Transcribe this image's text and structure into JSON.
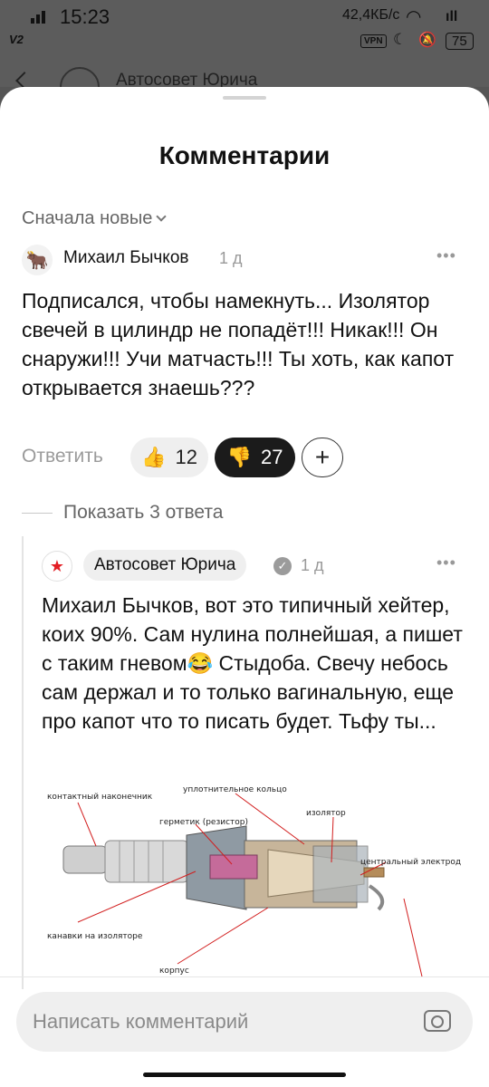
{
  "status_bar": {
    "time": "15:23",
    "carrier_tag": "V2",
    "net_speed": "42,4КБ/с",
    "vpn": "VPN",
    "battery": "75"
  },
  "background": {
    "channel_title": "Автосовет Юрича"
  },
  "sheet": {
    "title": "Комментарии",
    "sort_label": "Сначала новые"
  },
  "comment1": {
    "author": "Михаил Бычков",
    "time": "1 д",
    "text": "Подписался, чтобы намекнуть... Изолятор свечей в цилиндр не попадёт!!! Никак!!! Он снаружи!!! Учи матчасть!!! Ты хоть, как капот открывается знаешь???",
    "reply_label": "Ответить",
    "likes": "12",
    "dislikes": "27",
    "show_replies": "Показать 3 ответа"
  },
  "comment2": {
    "author": "Автосовет Юрича",
    "time": "1 д",
    "text": "Михаил Бычков, вот это типичный хейтер, коих 90%. Сам нулина полнейшая, а пишет с таким гневом😂 Стыдоба. Свечу небось сам держал и то только вагинальную, еще про капот что то писать будет. Тьфу ты...",
    "image_labels": {
      "tip": "контактный наконечник",
      "ring": "уплотнительное кольцо",
      "sealant": "герметик (резистор)",
      "insulator": "изолятор",
      "electrode": "центральный электрод",
      "grooves": "канавки на изоляторе",
      "body": "корпус"
    }
  },
  "input": {
    "placeholder": "Написать комментарий"
  },
  "icons": {
    "more": "more-dots-icon",
    "camera": "camera-icon",
    "like": "thumb-up-icon",
    "dislike": "thumb-down-icon",
    "add_reaction": "plus-icon"
  },
  "colors": {
    "dislike_bg": "#1b1b1b",
    "accent_red": "#e31e24"
  }
}
